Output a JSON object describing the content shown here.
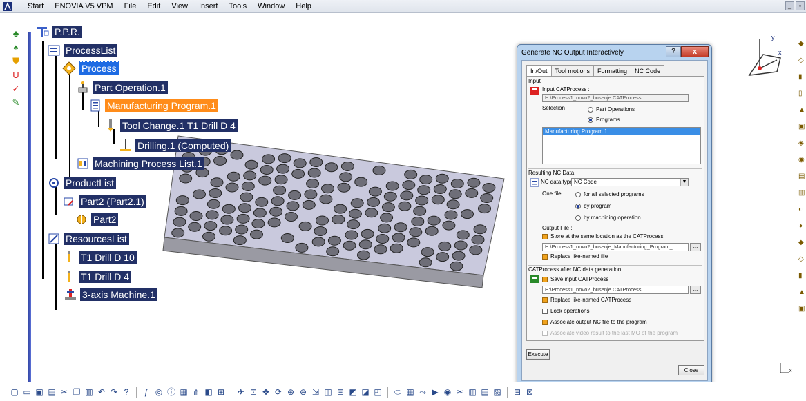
{
  "menubar": {
    "items": [
      "Start",
      "ENOVIA V5 VPM",
      "File",
      "Edit",
      "View",
      "Insert",
      "Tools",
      "Window",
      "Help"
    ]
  },
  "tree": {
    "root": "P.P.R.",
    "process_list": "ProcessList",
    "process": "Process",
    "part_operation": "Part Operation.1",
    "manufacturing_program": "Manufacturing Program.1",
    "tool_change": "Tool Change.1  T1 Drill D 4",
    "drilling": "Drilling.1 (Computed)",
    "machining_process_list": "Machining Process List.1",
    "product_list": "ProductList",
    "part2_instance": "Part2 (Part2.1)",
    "part2": "Part2",
    "resources_list": "ResourcesList",
    "drill_d10": "T1 Drill D 10",
    "drill_d4": "T1 Drill D 4",
    "machine": "3-axis Machine.1"
  },
  "dialog": {
    "title": "Generate NC Output Interactively",
    "help_btn": "?",
    "close_btn": "x",
    "tabs": [
      "In/Out",
      "Tool motions",
      "Formatting",
      "NC Code"
    ],
    "input": {
      "section": "Input",
      "catprocess_label": "Input CATProcess :",
      "catprocess_value": "H:\\Process1_novo2_busenje.CATProcess",
      "selection_label": "Selection",
      "radio_part_operations": "Part Operations",
      "radio_programs": "Programs",
      "list_items": [
        "Manufacturing Program.1"
      ]
    },
    "resulting": {
      "section": "Resulting NC Data",
      "nc_type_label": "NC data type:",
      "nc_type_value": "NC Code",
      "one_file_label": "One file...",
      "radio_all": "for all selected programs",
      "radio_by_program": "by program",
      "radio_by_op": "by machining operation",
      "output_file_label": "Output File :",
      "store_same_location": "Store at the same location as the CATProcess",
      "output_path": "H:\\Process1_novo2_busenje_Manufacturing_Program_",
      "replace_like_named": "Replace like-named file"
    },
    "after": {
      "section": "CATProcess after NC data generation",
      "save_input": "Save input CATProcess :",
      "save_path": "H:\\Process1_novo2_busenje.CATProcess",
      "replace_catprocess": "Replace like-named CATProcess",
      "lock_operations": "Lock operations",
      "associate_nc": "Associate output NC file to the program",
      "associate_video": "Associate video result to the last MO of the program"
    },
    "execute_btn": "Execute",
    "close_button": "Close",
    "browse_label": "..."
  },
  "compass": {
    "x_label": "x",
    "y_label": "y"
  },
  "axis_marker": {
    "label": "x"
  }
}
